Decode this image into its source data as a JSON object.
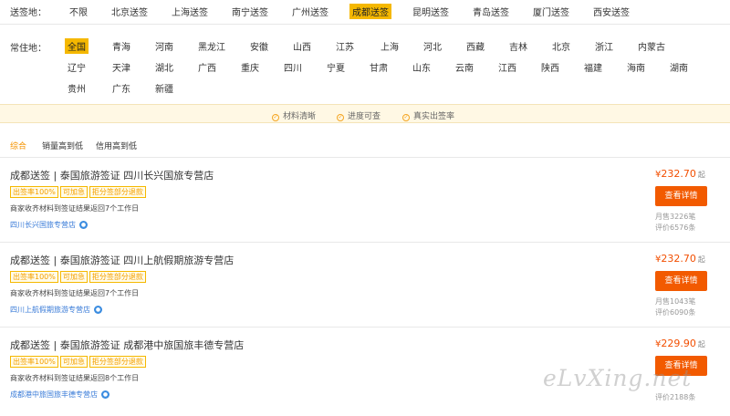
{
  "filters": {
    "send_label": "送签地：",
    "send_options": [
      "不限",
      "北京送签",
      "上海送签",
      "南宁送签",
      "广州送签",
      "成都送签",
      "昆明送签",
      "青岛送签",
      "厦门送签",
      "西安送签"
    ],
    "send_selected": "成都送签",
    "residence_label": "常住地：",
    "residence_options": [
      [
        "全国",
        "青海",
        "河南",
        "黑龙江",
        "安徽",
        "山西",
        "江苏",
        "上海",
        "河北",
        "西藏",
        "吉林",
        "北京",
        "浙江",
        "内蒙古"
      ],
      [
        "辽宁",
        "天津",
        "湖北",
        "广西",
        "重庆",
        "四川",
        "宁夏",
        "甘肃",
        "山东",
        "云南",
        "江西",
        "陕西",
        "福建",
        "海南",
        "湖南"
      ],
      [
        "贵州",
        "广东",
        "新疆"
      ]
    ],
    "residence_selected": "全国"
  },
  "features": [
    "材料清晰",
    "进度可查",
    "真实出签率"
  ],
  "sort_tabs": [
    "综合",
    "销量高到低",
    "信用高到低"
  ],
  "sort_active": "综合",
  "products": [
    {
      "title": "成都送签 | 泰国旅游签证 四川长兴国旅专营店",
      "tags": [
        "出签率100%",
        "可加急",
        "拒分签部分退款"
      ],
      "desc": "商家收齐材料到签证结果返回7个工作日",
      "shop": "四川长兴国旅专营店",
      "price": "232.70",
      "currency": "¥",
      "price_suffix": "起",
      "button": "查看详情",
      "sales": "月售3226笔",
      "reviews": "评价6576条"
    },
    {
      "title": "成都送签 | 泰国旅游签证 四川上航假期旅游专营店",
      "tags": [
        "出签率100%",
        "可加急",
        "拒分签部分退款"
      ],
      "desc": "商家收齐材料到签证结果返回7个工作日",
      "shop": "四川上航假期旅游专营店",
      "price": "232.70",
      "currency": "¥",
      "price_suffix": "起",
      "button": "查看详情",
      "sales": "月售1043笔",
      "reviews": "评价6090条"
    },
    {
      "title": "成都送签 | 泰国旅游签证 成都港中旅国旅丰德专营店",
      "tags": [
        "出签率100%",
        "可加急",
        "拒分签部分退款"
      ],
      "desc": "商家收齐材料到签证结果返回8个工作日",
      "shop": "成都港中旅国旅丰德专营店",
      "price": "229.90",
      "currency": "¥",
      "price_suffix": "起",
      "button": "查看详情",
      "sales": "",
      "reviews": "评价2188条"
    }
  ],
  "watermark": "eLvXing.net",
  "colors": {
    "accent_yellow": "#f5b800",
    "price_red": "#f24e00",
    "button_orange": "#f25a00",
    "link_blue": "#3b7cd8",
    "banner_bg": "#fff8e4"
  }
}
